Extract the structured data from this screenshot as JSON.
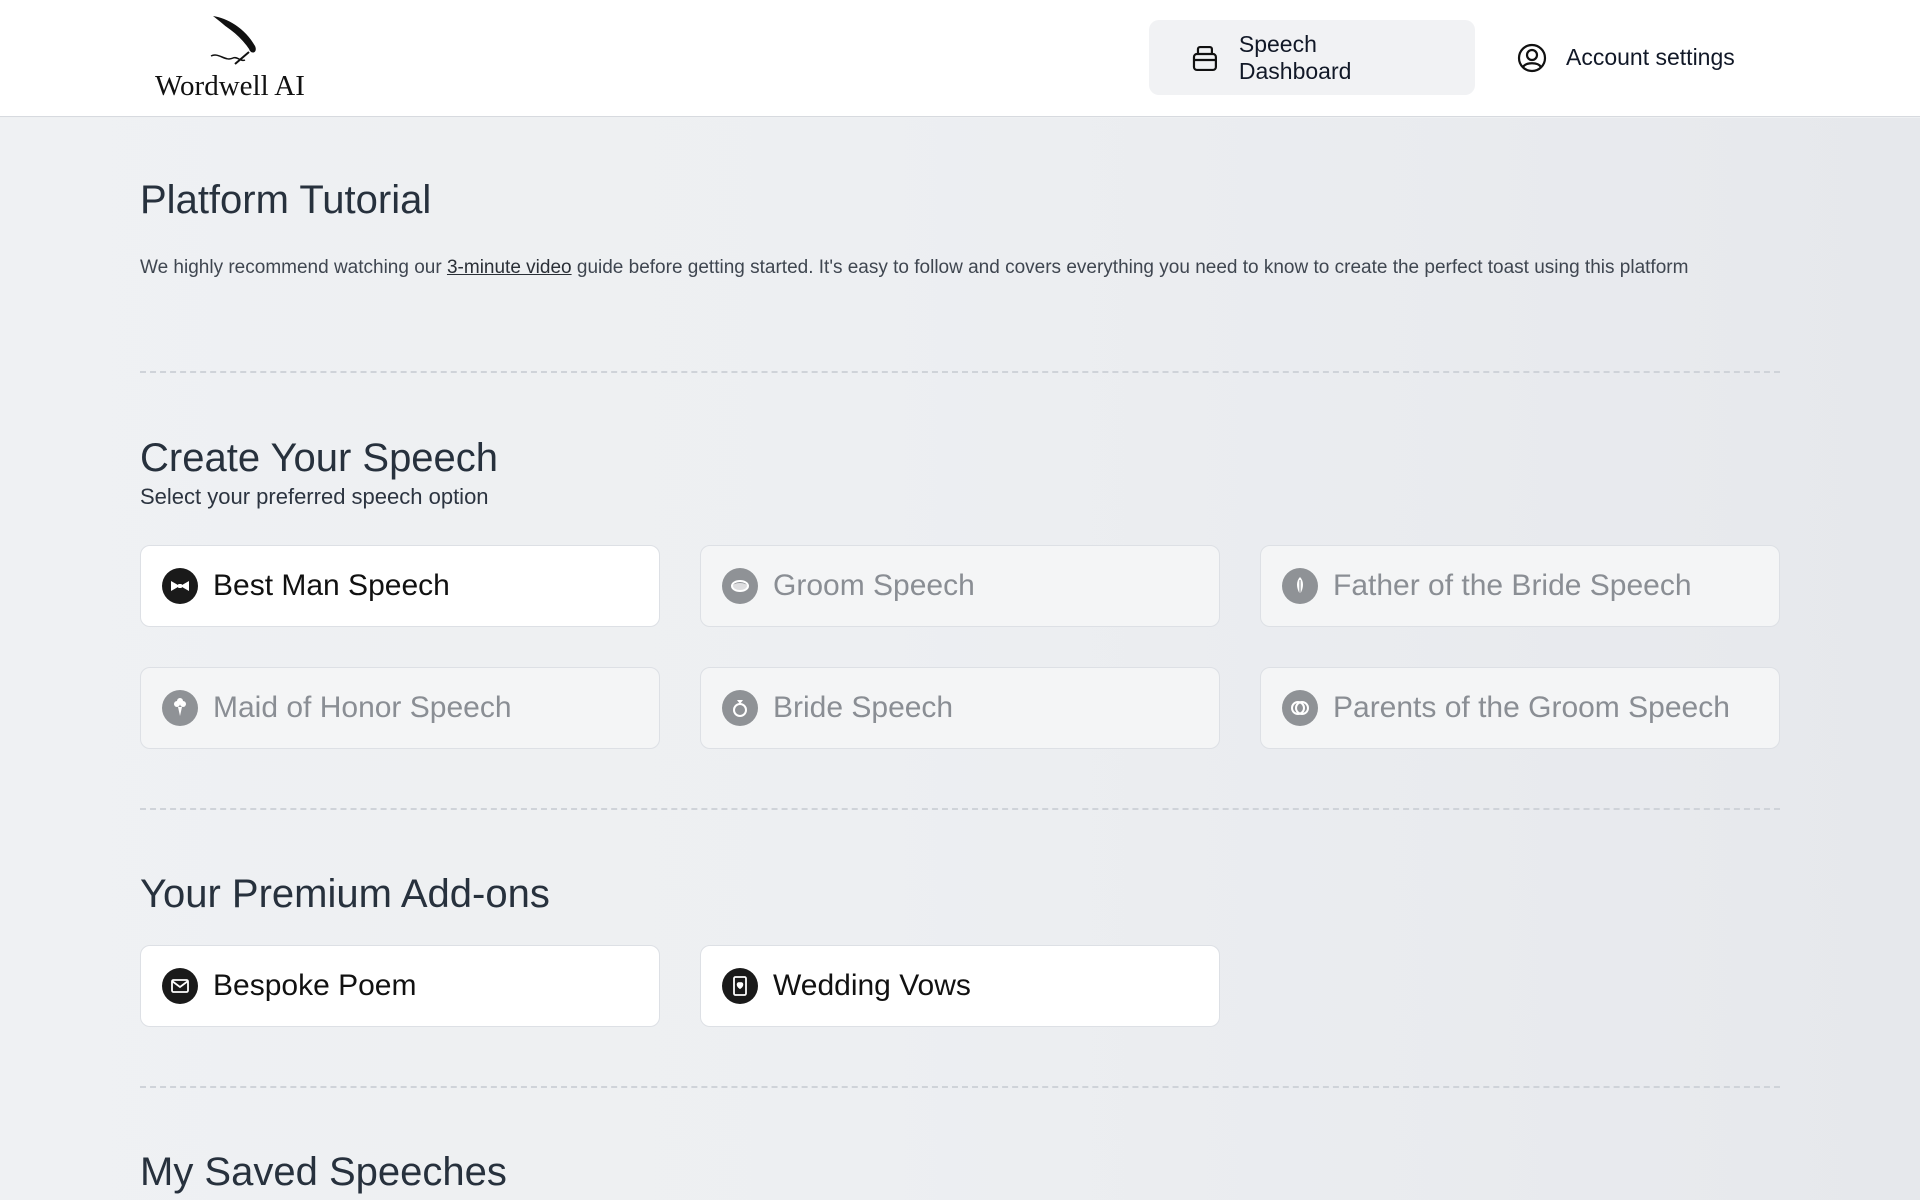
{
  "brand": {
    "name": "Wordwell AI",
    "logo_icon": "quill-icon"
  },
  "nav": {
    "dashboard": {
      "label": "Speech Dashboard",
      "icon": "dashboard-icon"
    },
    "account": {
      "label": "Account settings",
      "icon": "user-circle-icon"
    }
  },
  "tutorial": {
    "title": "Platform Tutorial",
    "text_before": "We highly recommend watching our ",
    "link": "3-minute video",
    "text_after": " guide before getting started. It's easy to follow and covers everything you need to know to create the perfect toast using this platform"
  },
  "create": {
    "title": "Create Your Speech",
    "subtitle": "Select your preferred speech option",
    "options": [
      {
        "label": "Best Man Speech",
        "icon": "bowtie-icon",
        "enabled": true
      },
      {
        "label": "Groom Speech",
        "icon": "ring-icon",
        "enabled": false
      },
      {
        "label": "Father of the Bride Speech",
        "icon": "feather-icon",
        "enabled": false
      },
      {
        "label": "Maid of Honor Speech",
        "icon": "bouquet-icon",
        "enabled": false
      },
      {
        "label": "Bride Speech",
        "icon": "diamond-ring-icon",
        "enabled": false
      },
      {
        "label": "Parents of the Groom Speech",
        "icon": "interlocked-rings-icon",
        "enabled": false
      }
    ]
  },
  "addons": {
    "title": "Your Premium Add-ons",
    "items": [
      {
        "label": "Bespoke Poem",
        "icon": "envelope-icon"
      },
      {
        "label": "Wedding Vows",
        "icon": "book-heart-icon"
      }
    ]
  },
  "saved": {
    "title": "My Saved Speeches"
  },
  "colors": {
    "card_enabled": "#ffffff",
    "card_disabled": "#f4f5f6",
    "text_disabled": "#8a8e94"
  }
}
